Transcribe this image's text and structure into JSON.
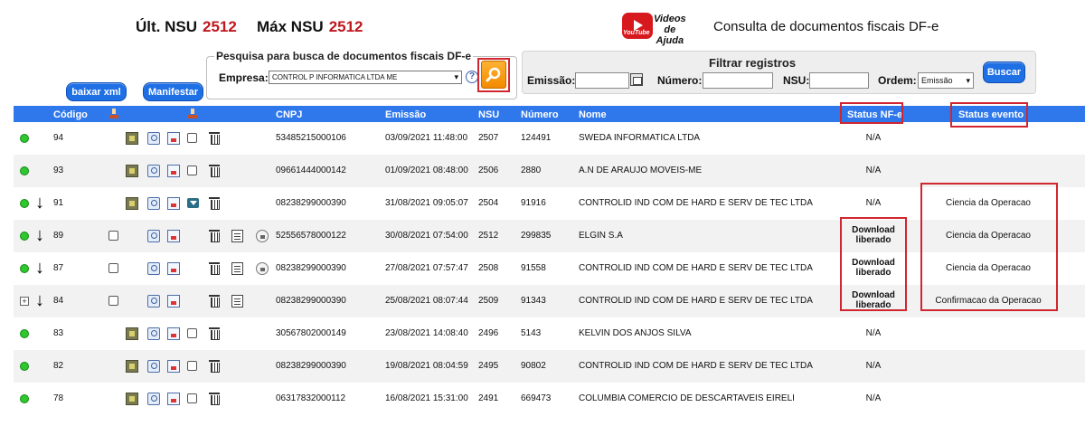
{
  "header": {
    "ult_nsu_label": "Últ. NSU",
    "ult_nsu_value": "2512",
    "max_nsu_label": "Máx NSU",
    "max_nsu_value": "2512",
    "videos_logo_text": "Videos de Ajuda",
    "youtube_text": "YouTube",
    "site_title": "Consulta de documentos fiscais DF-e"
  },
  "actions": {
    "baixar_xml": "baixar xml",
    "manifestar": "Manifestar"
  },
  "search": {
    "legend": "Pesquisa para busca de documentos fiscais DF-e",
    "empresa_label": "Empresa:",
    "empresa_value": "CONTROL P INFORMATICA LTDA ME",
    "help_glyph": "?"
  },
  "filter": {
    "title": "Filtrar registros",
    "emissao_label": "Emissão:",
    "numero_label": "Número:",
    "nsu_label": "NSU:",
    "ordem_label": "Ordem:",
    "ordem_value": "Emissão",
    "buscar": "Buscar"
  },
  "table": {
    "columns": {
      "codigo": "Código",
      "cnpj": "CNPJ",
      "emissao": "Emissão",
      "nsu": "NSU",
      "numero": "Número",
      "nome": "Nome",
      "status_nfe": "Status NF-e",
      "status_evento": "Status evento"
    },
    "rows": [
      {
        "codigo": "94",
        "cnpj": "53485215000106",
        "emissao": "03/09/2021 11:48:00",
        "nsu": "2507",
        "numero": "124491",
        "nome": "SWEDA INFORMATICA LTDA",
        "status_nfe": "N/A",
        "status_evento": ""
      },
      {
        "codigo": "93",
        "cnpj": "09661444000142",
        "emissao": "01/09/2021 08:48:00",
        "nsu": "2506",
        "numero": "2880",
        "nome": "A.N DE ARAUJO MOVEIS-ME",
        "status_nfe": "N/A",
        "status_evento": ""
      },
      {
        "codigo": "91",
        "cnpj": "08238299000390",
        "emissao": "31/08/2021 09:05:07",
        "nsu": "2504",
        "numero": "91916",
        "nome": "CONTROLID IND COM DE HARD E SERV DE TEC LTDA",
        "status_nfe": "N/A",
        "status_evento": "Ciencia da Operacao"
      },
      {
        "codigo": "89",
        "cnpj": "52556578000122",
        "emissao": "30/08/2021 07:54:00",
        "nsu": "2512",
        "numero": "299835",
        "nome": "ELGIN S.A",
        "status_nfe": "Download liberado",
        "status_evento": "Ciencia da Operacao"
      },
      {
        "codigo": "87",
        "cnpj": "08238299000390",
        "emissao": "27/08/2021 07:57:47",
        "nsu": "2508",
        "numero": "91558",
        "nome": "CONTROLID IND COM DE HARD E SERV DE TEC LTDA",
        "status_nfe": "Download liberado",
        "status_evento": "Ciencia da Operacao"
      },
      {
        "codigo": "84",
        "cnpj": "08238299000390",
        "emissao": "25/08/2021 08:07:44",
        "nsu": "2509",
        "numero": "91343",
        "nome": "CONTROLID IND COM DE HARD E SERV DE TEC LTDA",
        "status_nfe": "Download liberado",
        "status_evento": "Confirmacao da Operacao"
      },
      {
        "codigo": "83",
        "cnpj": "30567802000149",
        "emissao": "23/08/2021 14:08:40",
        "nsu": "2496",
        "numero": "5143",
        "nome": "KELVIN DOS ANJOS SILVA",
        "status_nfe": "N/A",
        "status_evento": ""
      },
      {
        "codigo": "82",
        "cnpj": "08238299000390",
        "emissao": "19/08/2021 08:04:59",
        "nsu": "2495",
        "numero": "90802",
        "nome": "CONTROLID IND COM DE HARD E SERV DE TEC LTDA",
        "status_nfe": "N/A",
        "status_evento": ""
      },
      {
        "codigo": "78",
        "cnpj": "06317832000112",
        "emissao": "16/08/2021 15:31:00",
        "nsu": "2491",
        "numero": "669473",
        "nome": "COLUMBIA COMERCIO DE DESCARTAVEIS EIRELI",
        "status_nfe": "N/A",
        "status_evento": ""
      }
    ]
  },
  "colors": {
    "header_bar": "#2f78ec",
    "highlight_red": "#d1262f",
    "nsu_red": "#c0171e",
    "status_green": "#2ec72e"
  }
}
